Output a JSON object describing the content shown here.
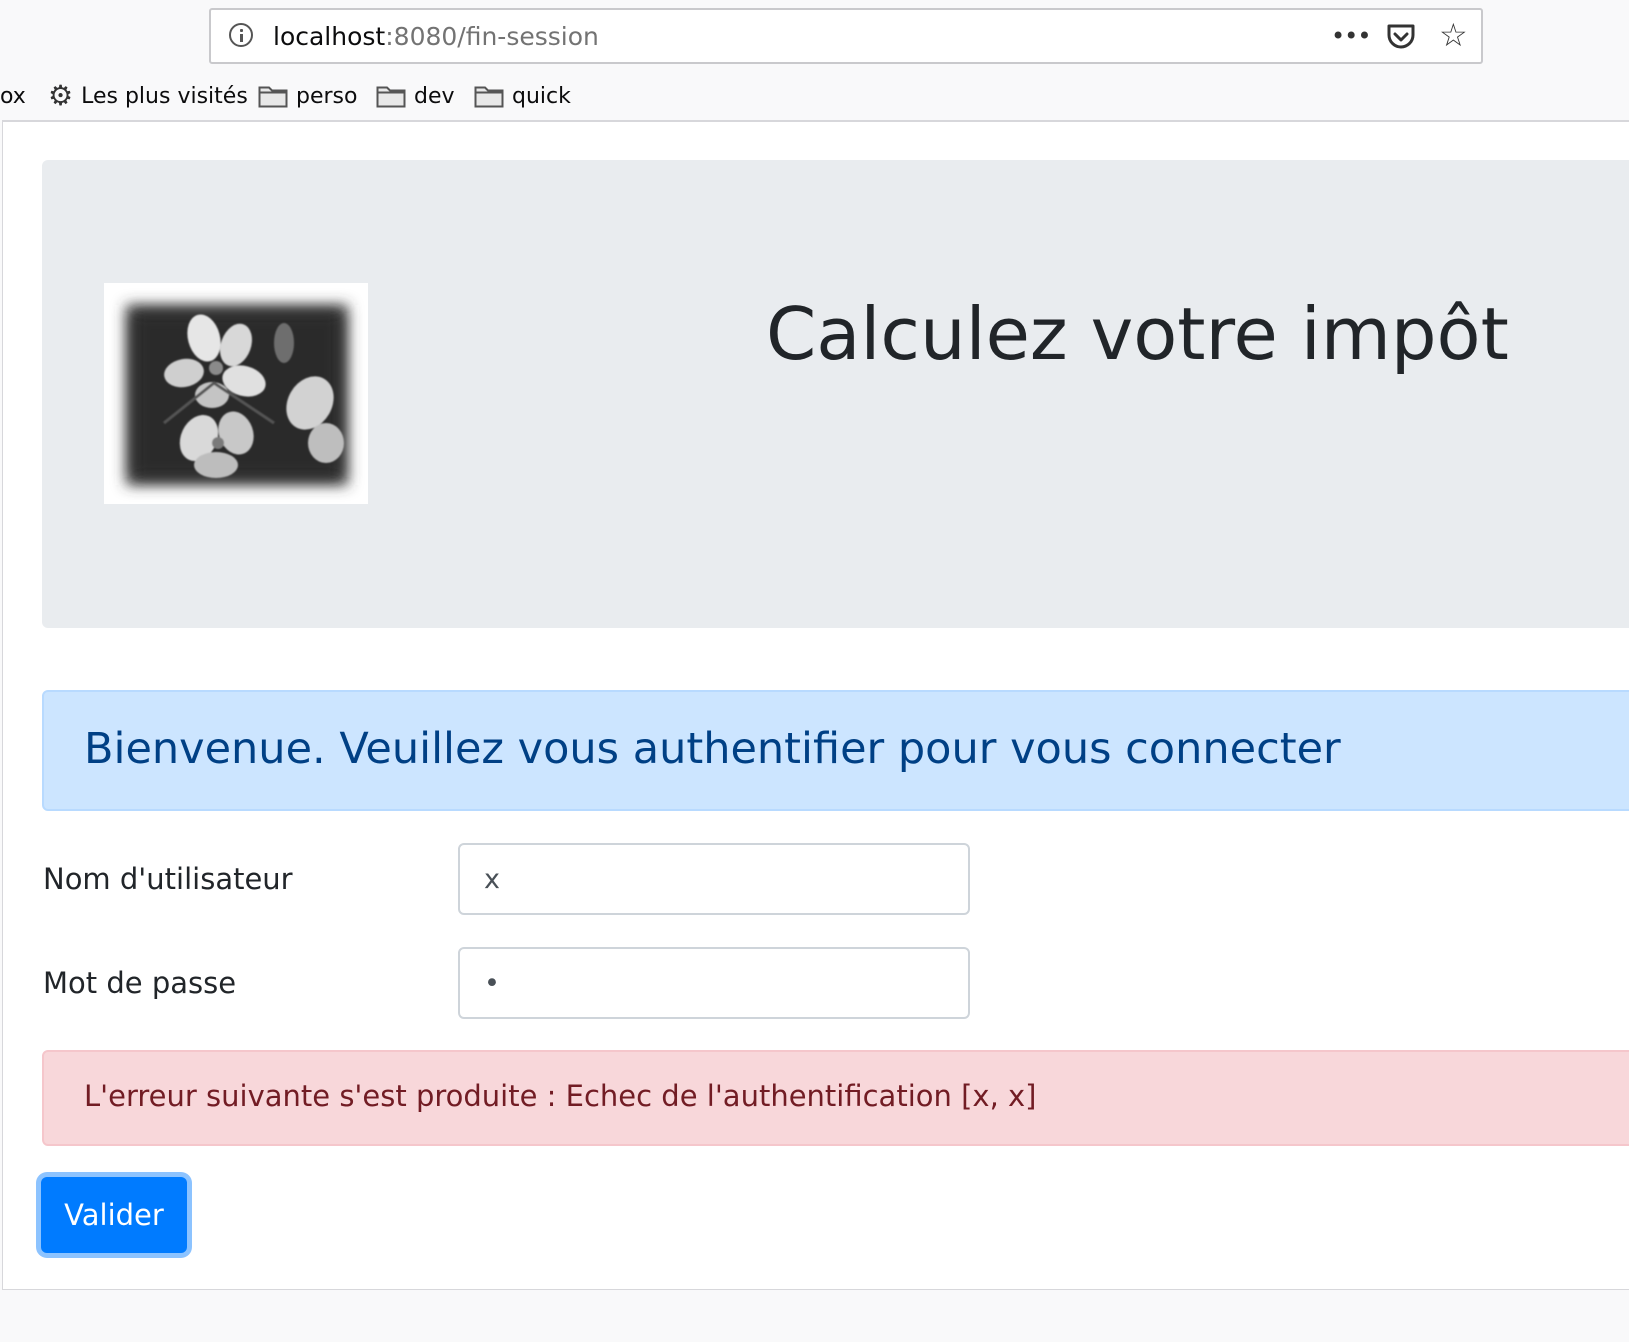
{
  "browser": {
    "url_host": "localhost",
    "url_rest": ":8080/fin-session",
    "bookmarks": {
      "partial": "ox",
      "most_visited": "Les plus visités",
      "folders": [
        "perso",
        "dev",
        "quick"
      ]
    },
    "icons": [
      "info-icon",
      "more-dots-icon",
      "pocket-icon",
      "bookmark-star-icon",
      "gear-icon",
      "folder-icon"
    ]
  },
  "header": {
    "title": "Calculez votre impôt",
    "logo": "flower-photo"
  },
  "welcome": {
    "message": "Bienvenue. Veuillez vous authentifier pour vous connecter"
  },
  "form": {
    "username_label": "Nom d'utilisateur",
    "username_value": "x",
    "password_label": "Mot de passe",
    "password_value": "x"
  },
  "error": {
    "message": "L'erreur suivante s'est produite : Echec de l'authentification [x, x]"
  },
  "submit": {
    "label": "Valider"
  },
  "colors": {
    "primary": "#007bff",
    "info_bg": "#cce5ff",
    "info_text": "#004085",
    "danger_bg": "#f8d7da",
    "danger_text": "#721c24",
    "jumbotron_bg": "#e9ecef"
  }
}
